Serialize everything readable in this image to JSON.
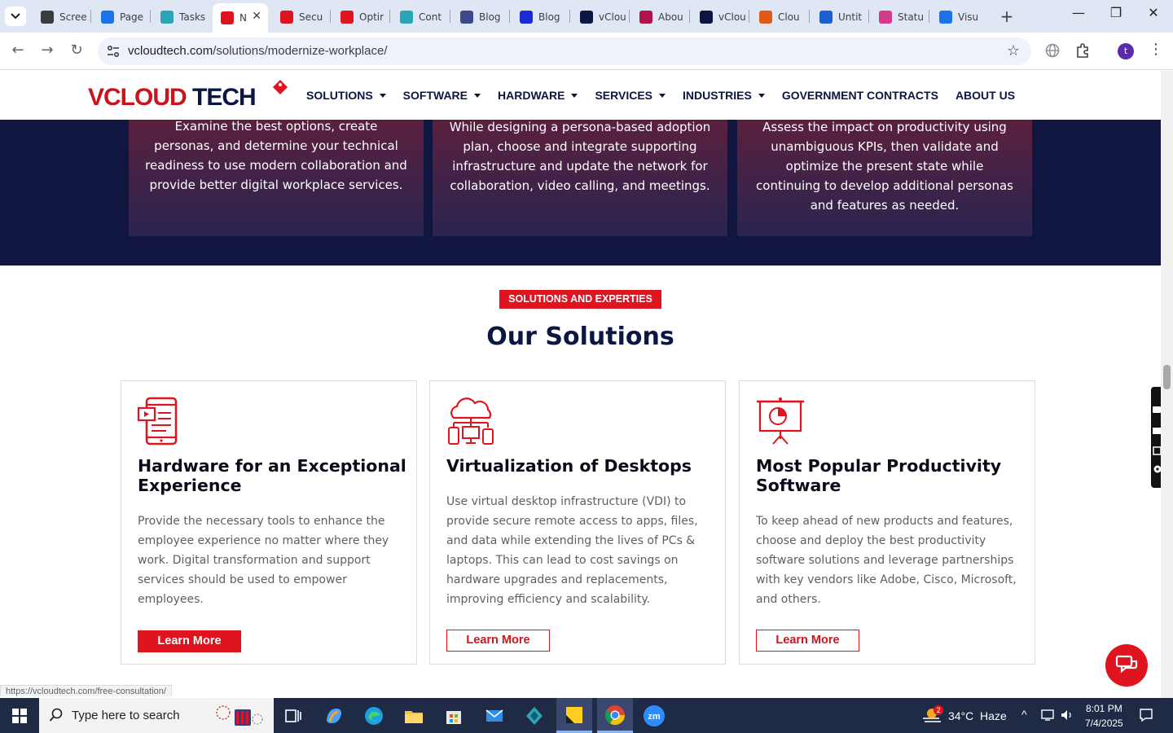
{
  "browser": {
    "tabs": [
      {
        "title": "Scree",
        "color": "#3c3c3c"
      },
      {
        "title": "Page",
        "color": "#1a73e8"
      },
      {
        "title": "Tasks",
        "color": "#2aa5b8"
      },
      {
        "title": "N",
        "color": "#e0141e",
        "active": true
      },
      {
        "title": "Secu",
        "color": "#e0141e"
      },
      {
        "title": "Optir",
        "color": "#e0141e"
      },
      {
        "title": "Cont",
        "color": "#2aa5b8"
      },
      {
        "title": "Blog",
        "color": "#3c4a8c"
      },
      {
        "title": "Blog",
        "color": "#1a2bd4"
      },
      {
        "title": "vClou",
        "color": "#0b1643"
      },
      {
        "title": "Abou",
        "color": "#b0144a"
      },
      {
        "title": "vClou",
        "color": "#0b1643"
      },
      {
        "title": "Clou",
        "color": "#e05a14"
      },
      {
        "title": "Untit",
        "color": "#1a5fd4"
      },
      {
        "title": "Statu",
        "color": "#d43a8c"
      },
      {
        "title": "Visu",
        "color": "#1a73e8"
      }
    ],
    "url_domain": "vcloudtech.com",
    "url_path": "/solutions/modernize-workplace/",
    "status_url": "https://vcloudtech.com/free-consultation/",
    "profile_initial": "t"
  },
  "site": {
    "logo_left": "VCLOUD",
    "logo_right": "TECH",
    "nav": [
      {
        "label": "SOLUTIONS",
        "dropdown": true
      },
      {
        "label": "SOFTWARE",
        "dropdown": true
      },
      {
        "label": "HARDWARE",
        "dropdown": true
      },
      {
        "label": "SERVICES",
        "dropdown": true
      },
      {
        "label": "INDUSTRIES",
        "dropdown": true
      },
      {
        "label": "GOVERNMENT CONTRACTS",
        "dropdown": false
      },
      {
        "label": "ABOUT US",
        "dropdown": false
      }
    ],
    "steps": [
      "Examine the best options, create personas, and determine your technical readiness to use modern collaboration and provide better digital workplace services.",
      "While designing a persona-based adoption plan, choose and integrate supporting infrastructure and update the network for collaboration, video calling, and meetings.",
      "Assess the impact on productivity using unambiguous KPIs, then validate and optimize the present state while continuing to develop additional personas and features as needed."
    ],
    "section_pill": "SOLUTIONS AND EXPERTIES",
    "section_title": "Our Solutions",
    "solutions": [
      {
        "title": "Hardware for an Exceptional Experience",
        "desc": "Provide the necessary tools to enhance the employee experience no matter where they work. Digital transformation and support services should be used to empower employees.",
        "button": "Learn More",
        "icon": "tablet-icon"
      },
      {
        "title": "Virtualization of Desktops",
        "desc": "Use virtual desktop infrastructure (VDI) to provide secure remote access to apps, files, and data while extending the lives of PCs & laptops. This can lead to cost savings on hardware upgrades and replacements, improving efficiency and scalability.",
        "button": "Learn More",
        "icon": "cloud-devices-icon"
      },
      {
        "title": "Most Popular Productivity Software",
        "desc": "To keep ahead of new products and features, choose and deploy the best productivity software solutions and leverage partnerships with key vendors like Adobe, Cisco, Microsoft, and others.",
        "button": "Learn More",
        "icon": "presentation-icon"
      }
    ],
    "accent": "#e0141e",
    "navy": "#0b1643"
  },
  "taskbar": {
    "search_placeholder": "Type here to search",
    "weather": "34°C  Haze",
    "weather_badge": "2",
    "time": "8:01 PM",
    "date": "7/4/2025"
  }
}
